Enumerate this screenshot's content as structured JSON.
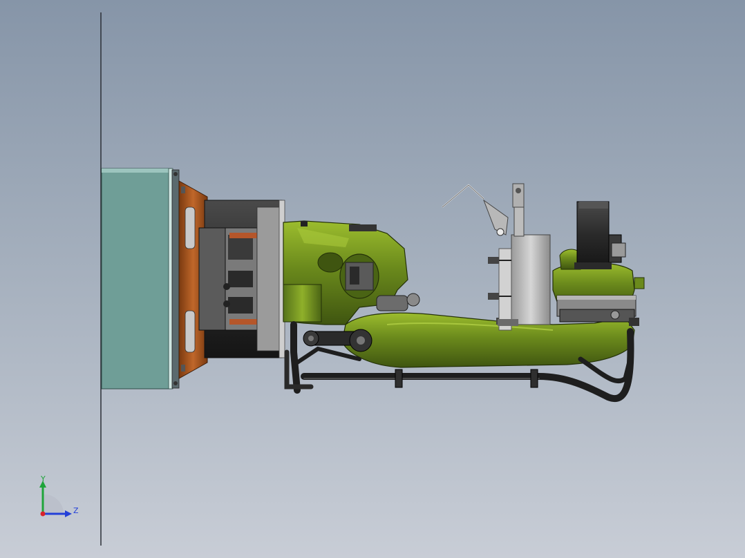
{
  "view": {
    "background_top": "#8695a8",
    "background_bottom": "#c8cdd6",
    "model_colors": {
      "arm_green": "#6b8a1c",
      "arm_green_dark": "#3f5510",
      "base_plate": "#6f9e97",
      "flange_orange": "#a2521b",
      "motor_black": "#2b2b2b",
      "bracket_grey": "#c9c9c9",
      "cable_black": "#1e1e1e"
    }
  },
  "triad": {
    "y_label": "Y",
    "z_label": "Z",
    "y_color": "#1fa43a",
    "z_color": "#2340d8",
    "x_color": "#d8232a"
  }
}
